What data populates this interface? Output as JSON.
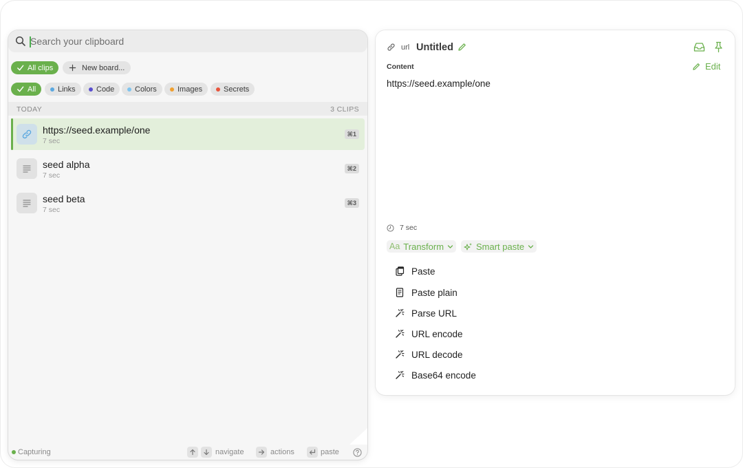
{
  "search": {
    "placeholder": "Search your clipboard"
  },
  "boards": {
    "all_clips": "All clips",
    "new_board": "New board..."
  },
  "filters": [
    {
      "label": "All",
      "active": true
    },
    {
      "label": "Links",
      "color": "#5ba8e0"
    },
    {
      "label": "Code",
      "color": "#5a4fcf"
    },
    {
      "label": "Colors",
      "color": "#7fc4ee"
    },
    {
      "label": "Images",
      "color": "#f0a030"
    },
    {
      "label": "Secrets",
      "color": "#e8553d"
    }
  ],
  "section": {
    "label": "TODAY",
    "count": "3 CLIPS"
  },
  "clips": [
    {
      "title": "https://seed.example/one",
      "time": "7 sec",
      "key": "⌘1",
      "icon": "link-icon",
      "selected": true
    },
    {
      "title": "seed alpha",
      "time": "7 sec",
      "key": "⌘2",
      "icon": "text-icon"
    },
    {
      "title": "seed beta",
      "time": "7 sec",
      "key": "⌘3",
      "icon": "text-icon"
    }
  ],
  "footer": {
    "status": "Capturing",
    "navigate": "navigate",
    "actions": "actions",
    "paste": "paste"
  },
  "detail": {
    "type": "url",
    "title": "Untitled",
    "content_label": "Content",
    "edit_label": "Edit",
    "content": "https://seed.example/one",
    "time": "7 sec",
    "transform": {
      "prefix": "Aa",
      "label": "Transform"
    },
    "smart_paste": "Smart paste",
    "actions": [
      "Paste",
      "Paste plain",
      "Parse URL",
      "URL encode",
      "URL decode",
      "Base64 encode"
    ]
  },
  "colors": {
    "accent": "#6ab04c",
    "selected_row": "#e3efdb"
  }
}
